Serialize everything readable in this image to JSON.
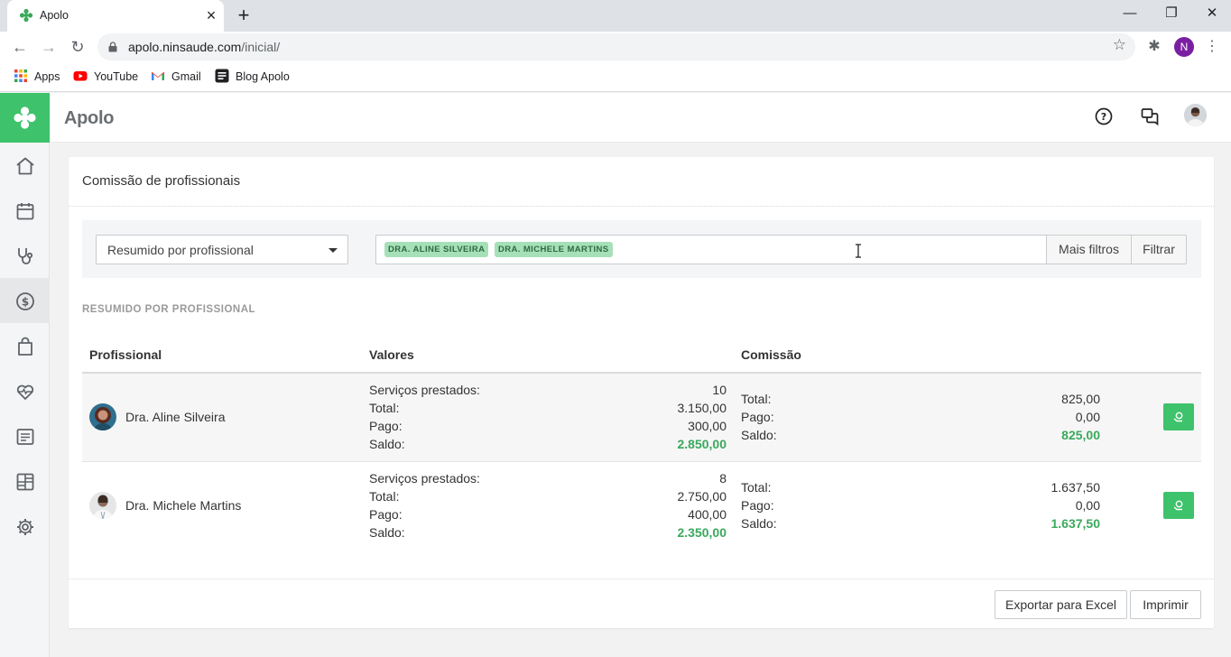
{
  "browser": {
    "tab_title": "Apolo",
    "url_domain": "apolo.ninsaude.com",
    "url_path": "/inicial/",
    "profile_initial": "N",
    "bookmarks": [
      {
        "label": "Apps",
        "icon": "apps-grid-icon"
      },
      {
        "label": "YouTube",
        "icon": "youtube-icon"
      },
      {
        "label": "Gmail",
        "icon": "gmail-icon"
      },
      {
        "label": "Blog Apolo",
        "icon": "blog-icon"
      }
    ]
  },
  "app": {
    "brand": "Apolo",
    "accent_color": "#3ec26b",
    "sidebar_icons": [
      "home-icon",
      "calendar-icon",
      "stethoscope-icon",
      "dollar-icon",
      "shopping-bag-icon",
      "heart-pulse-icon",
      "list-icon",
      "dashboard-icon",
      "settings-icon"
    ],
    "active_sidebar": "dollar-icon"
  },
  "page": {
    "title": "Comissão de profissionais",
    "filter": {
      "view_selected": "Resumido por profissional",
      "tags": [
        "DRA. ALINE SILVEIRA",
        "DRA. MICHELE MARTINS"
      ],
      "more_filters_label": "Mais filtros",
      "filter_label": "Filtrar"
    },
    "section_label": "RESUMIDO POR PROFISSIONAL",
    "table": {
      "headers": {
        "profissional": "Profissional",
        "valores": "Valores",
        "comissao": "Comissão"
      },
      "value_labels": {
        "servicos": "Serviços prestados:",
        "total": "Total:",
        "pago": "Pago:",
        "saldo": "Saldo:"
      },
      "rows": [
        {
          "name": "Dra. Aline Silveira",
          "servicos": "10",
          "total": "3.150,00",
          "pago": "300,00",
          "saldo": "2.850,00",
          "com_total": "825,00",
          "com_pago": "0,00",
          "com_saldo": "825,00"
        },
        {
          "name": "Dra. Michele Martins",
          "servicos": "8",
          "total": "2.750,00",
          "pago": "400,00",
          "saldo": "2.350,00",
          "com_total": "1.637,50",
          "com_pago": "0,00",
          "com_saldo": "1.637,50"
        }
      ]
    },
    "footer": {
      "export_label": "Exportar para Excel",
      "print_label": "Imprimir"
    }
  }
}
